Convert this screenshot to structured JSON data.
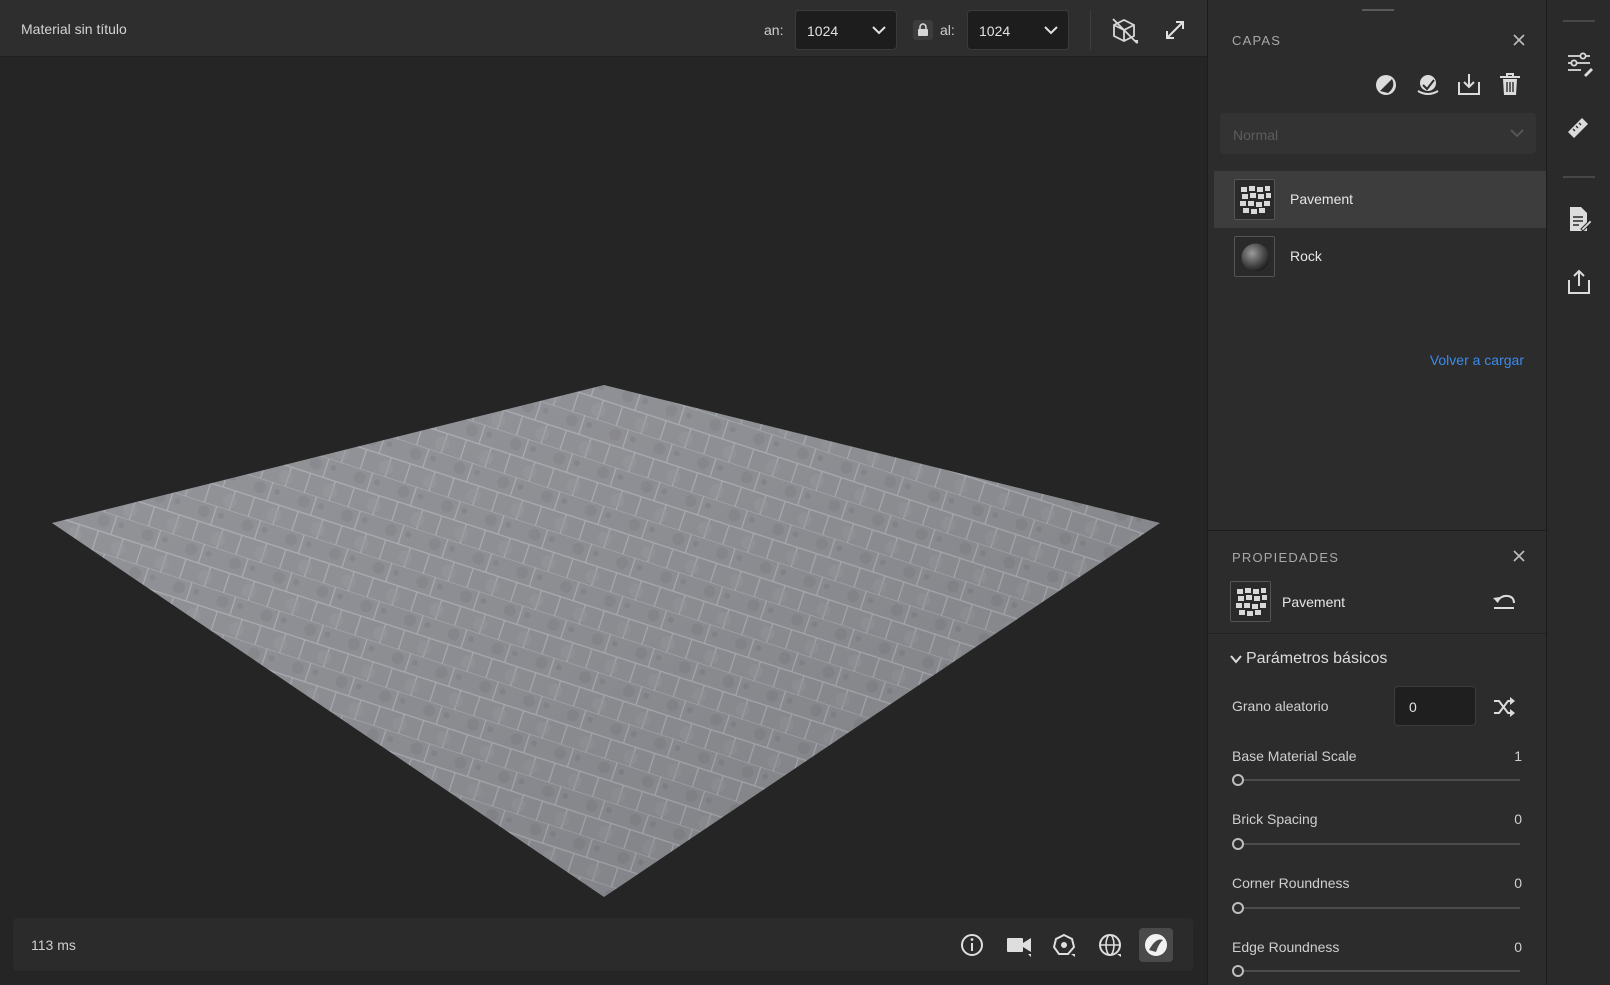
{
  "document": {
    "title": "Material sin título"
  },
  "size": {
    "width_label": "an:",
    "width_value": "1024",
    "height_label": "al:",
    "height_value": "1024",
    "locked": true
  },
  "toolbar_icons": [
    "3d-view-toggle-icon",
    "fullscreen-icon"
  ],
  "status": {
    "render_time": "113 ms",
    "icons": [
      "info-icon",
      "camera-icon",
      "lighting-icon",
      "environment-icon",
      "material-view-icon"
    ]
  },
  "layers_panel": {
    "title": "CAPAS",
    "actions": [
      "mask-icon",
      "fill-layer-icon",
      "import-icon",
      "trash-icon"
    ],
    "blend_mode": "Normal",
    "layers": [
      {
        "name": "Pavement",
        "thumb": "pavement-thumb",
        "selected": true
      },
      {
        "name": "Rock",
        "thumb": "rock-sphere-thumb",
        "selected": false
      }
    ],
    "reload_label": "Volver a cargar"
  },
  "properties_panel": {
    "title": "PROPIEDADES",
    "item_name": "Pavement",
    "section_title": "Parámetros básicos",
    "seed": {
      "label": "Grano aleatorio",
      "value": "0"
    },
    "params": [
      {
        "label": "Base Material Scale",
        "value": "1",
        "fraction": 0
      },
      {
        "label": "Brick Spacing",
        "value": "0",
        "fraction": 0
      },
      {
        "label": "Corner Roundness",
        "value": "0",
        "fraction": 0
      },
      {
        "label": "Edge Roundness",
        "value": "0",
        "fraction": 0
      }
    ]
  },
  "side_tools": [
    "adjustments-icon",
    "measure-icon",
    "document-icon",
    "export-icon"
  ],
  "colors": {
    "accent_link": "#3b8beb",
    "panel_bg": "#2c2c2c",
    "viewport_bg": "#252525"
  }
}
